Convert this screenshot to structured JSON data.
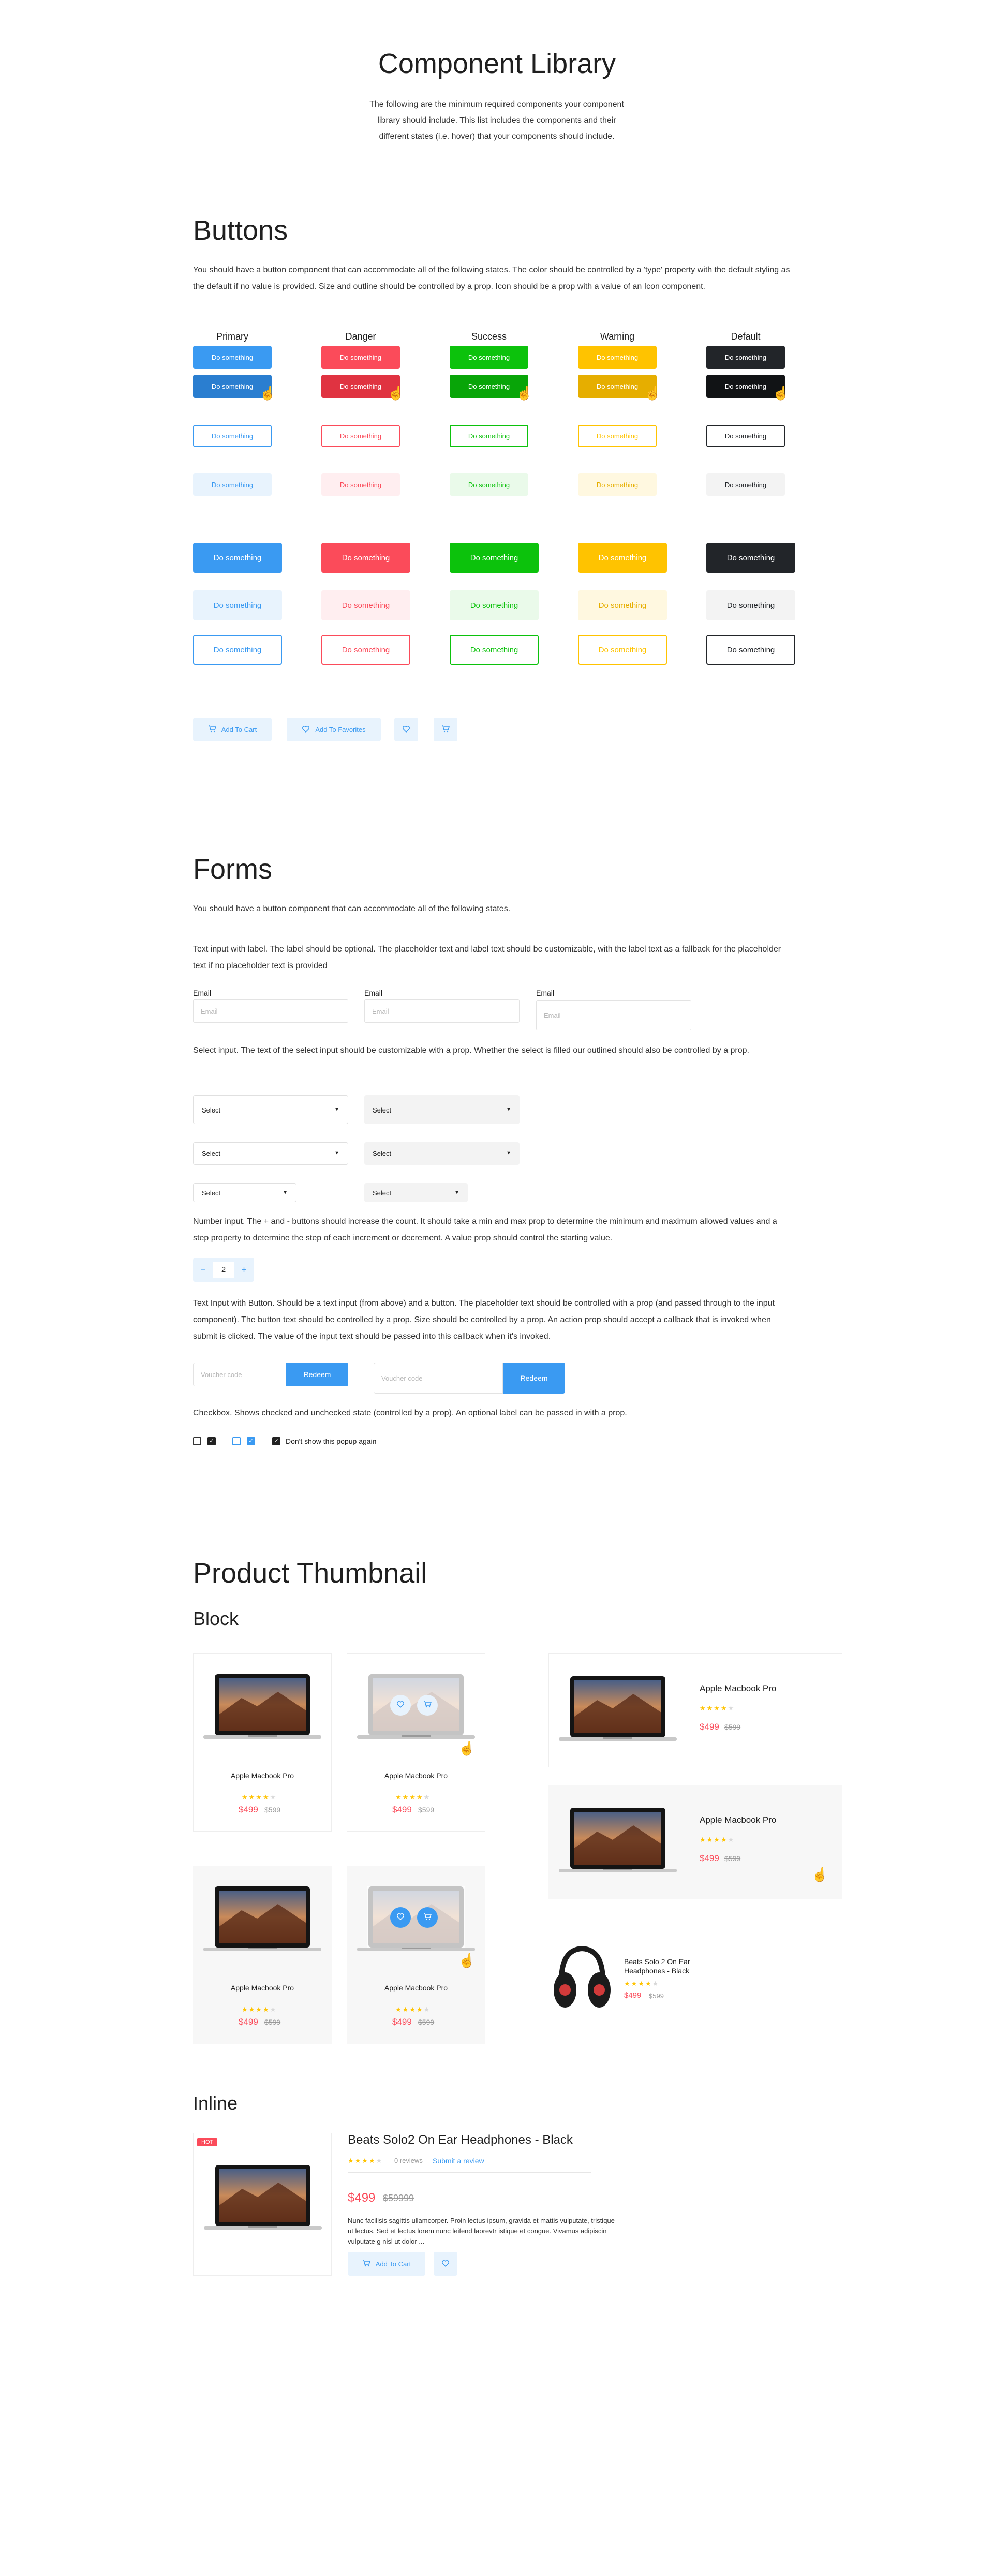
{
  "header": {
    "title": "Component Library",
    "intro_lines": [
      "The following are the minimum required components your component",
      "library should include. This list includes the components and their",
      "different states (i.e. hover) that your components should include."
    ]
  },
  "buttons": {
    "title": "Buttons",
    "description": "You should have a button component that can accommodate all of the following states. The color should be controlled by a 'type' property with the default styling as the default if no value is provided. Size and outline should be controlled by a prop. Icon should be a prop with a value of an Icon component.",
    "columns": [
      "Primary",
      "Danger",
      "Success",
      "Warning",
      "Default"
    ],
    "label": "Do something",
    "icon_buttons": {
      "add_to_cart": "Add To Cart",
      "add_to_favorites": "Add To Favorites"
    }
  },
  "forms": {
    "title": "Forms",
    "intro": "You should have a button component that can accommodate all of the following states.",
    "text_input_desc": "Text input with label. The label should be optional. The placeholder text and label text should be customizable, with the label text as a fallback for the placeholder text if no placeholder text is provided",
    "email_label": "Email",
    "email_placeholder": "Email",
    "select_desc": "Select input. The text of the select input should be customizable with a prop. Whether the select is filled our outlined should also be controlled by a prop.",
    "select_label": "Select",
    "number_desc": "Number input. The + and - buttons should increase the count. It should take a min and max prop to determine the minimum and maximum allowed values and a step property to determine the step of each increment or decrement. A value prop should control the starting value.",
    "stepper": {
      "minus": "−",
      "value": "2",
      "plus": "+"
    },
    "voucher_desc": "Text Input with Button. Should be a text input (from above) and a button. The placeholder text should be controlled with a prop (and passed through to the input component). The button text should be controlled by a prop. Size should be controlled by a prop.  An action prop should accept a callback that is invoked when submit is clicked. The value of the input text should be passed into this callback when it's invoked.",
    "voucher_placeholder": "Voucher code",
    "redeem_label": "Redeem",
    "checkbox_desc": "Checkbox. Shows checked and unchecked state (controlled by a prop). An optional label can be passed in with a prop.",
    "checkbox_label": "Don't show this popup again"
  },
  "product": {
    "title": "Product Thumbnail",
    "block_title": "Block",
    "inline_title": "Inline",
    "name": "Apple Macbook Pro",
    "price": "$499",
    "old_price": "$599",
    "rating": 4,
    "headphones": {
      "name_line1": "Beats Solo 2 On Ear",
      "name_line2": "Headphones - Black",
      "price": "$499",
      "old_price": "$599"
    },
    "inline": {
      "badge": "HOT",
      "name": "Beats Solo2 On Ear Headphones - Black",
      "reviews": "0 reviews",
      "submit_review": "Submit a review",
      "price": "$499",
      "old_price": "$59999",
      "desc_lines": [
        "Nunc facilisis sagittis ullamcorper. Proin lectus ipsum, gravida et mattis vulputate, tristique",
        "ut lectus. Sed et lectus lorem nunc leifend laorevtr istique et congue. Vivamus adipiscin",
        "vulputate g nisl ut dolor ..."
      ],
      "add_to_cart": "Add To Cart"
    }
  },
  "colors": {
    "primary": "#3a9af2",
    "danger": "#fb4b5a",
    "success": "#0cc20c",
    "warning": "#ffc300",
    "default": "#222529"
  }
}
